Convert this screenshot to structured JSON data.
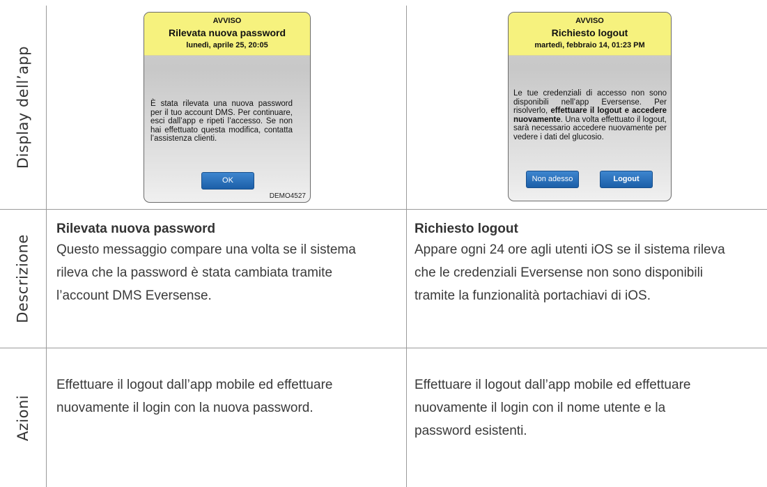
{
  "row_labels": {
    "display": "Display dell’app",
    "description": "Descrizione",
    "actions": "Azioni"
  },
  "dialog_left": {
    "header": "AVVISO",
    "title": "Rilevata nuova password",
    "date": "lunedì, aprile 25, 20:05",
    "message": "È stata rilevata una nuova password per il tuo account DMS. Per continuare, esci dall’app e ripeti l’accesso. Se non hai effettuato questa modifica, contatta l’assistenza clienti.",
    "ok_label": "OK",
    "demo_tag": "DEMO4527"
  },
  "dialog_right": {
    "header": "AVVISO",
    "title": "Richiesto logout",
    "date": "martedì, febbraio 14, 01:23 PM",
    "message_part1": "Le tue credenziali di accesso non sono disponibili nell’app Eversense. Per risolverlo, ",
    "message_bold": "effettuare il logout e accedere nuovamente",
    "message_part2": ". Una volta effettuato il logout, sarà necessario accedere nuovamente per vedere i dati del glucosio.",
    "not_now_label": "Non adesso",
    "logout_label": "Logout"
  },
  "description_left": {
    "title": "Rilevata nuova password",
    "body": "Questo messaggio compare una volta se il sistema\nrileva che la password è stata cambiata tramite\nl’account DMS Eversense."
  },
  "description_right": {
    "title": "Richiesto logout",
    "body": "Appare ogni 24 ore agli utenti iOS se il sistema rileva\nche le credenziali Eversense non sono disponibili\ntramite la funzionalità portachiavi di iOS."
  },
  "actions_left": {
    "body": "Effettuare il logout dall’app mobile ed effettuare\nnuovamente il login con la nuova password."
  },
  "actions_right": {
    "body": "Effettuare il logout dall’app mobile ed effettuare\nnuovamente il login con il nome utente e la\npassword esistenti."
  },
  "colors": {
    "dialog_header": "#f6f27e",
    "button_blue": "#1c5fa8",
    "grid_line": "#9a9a9a"
  }
}
